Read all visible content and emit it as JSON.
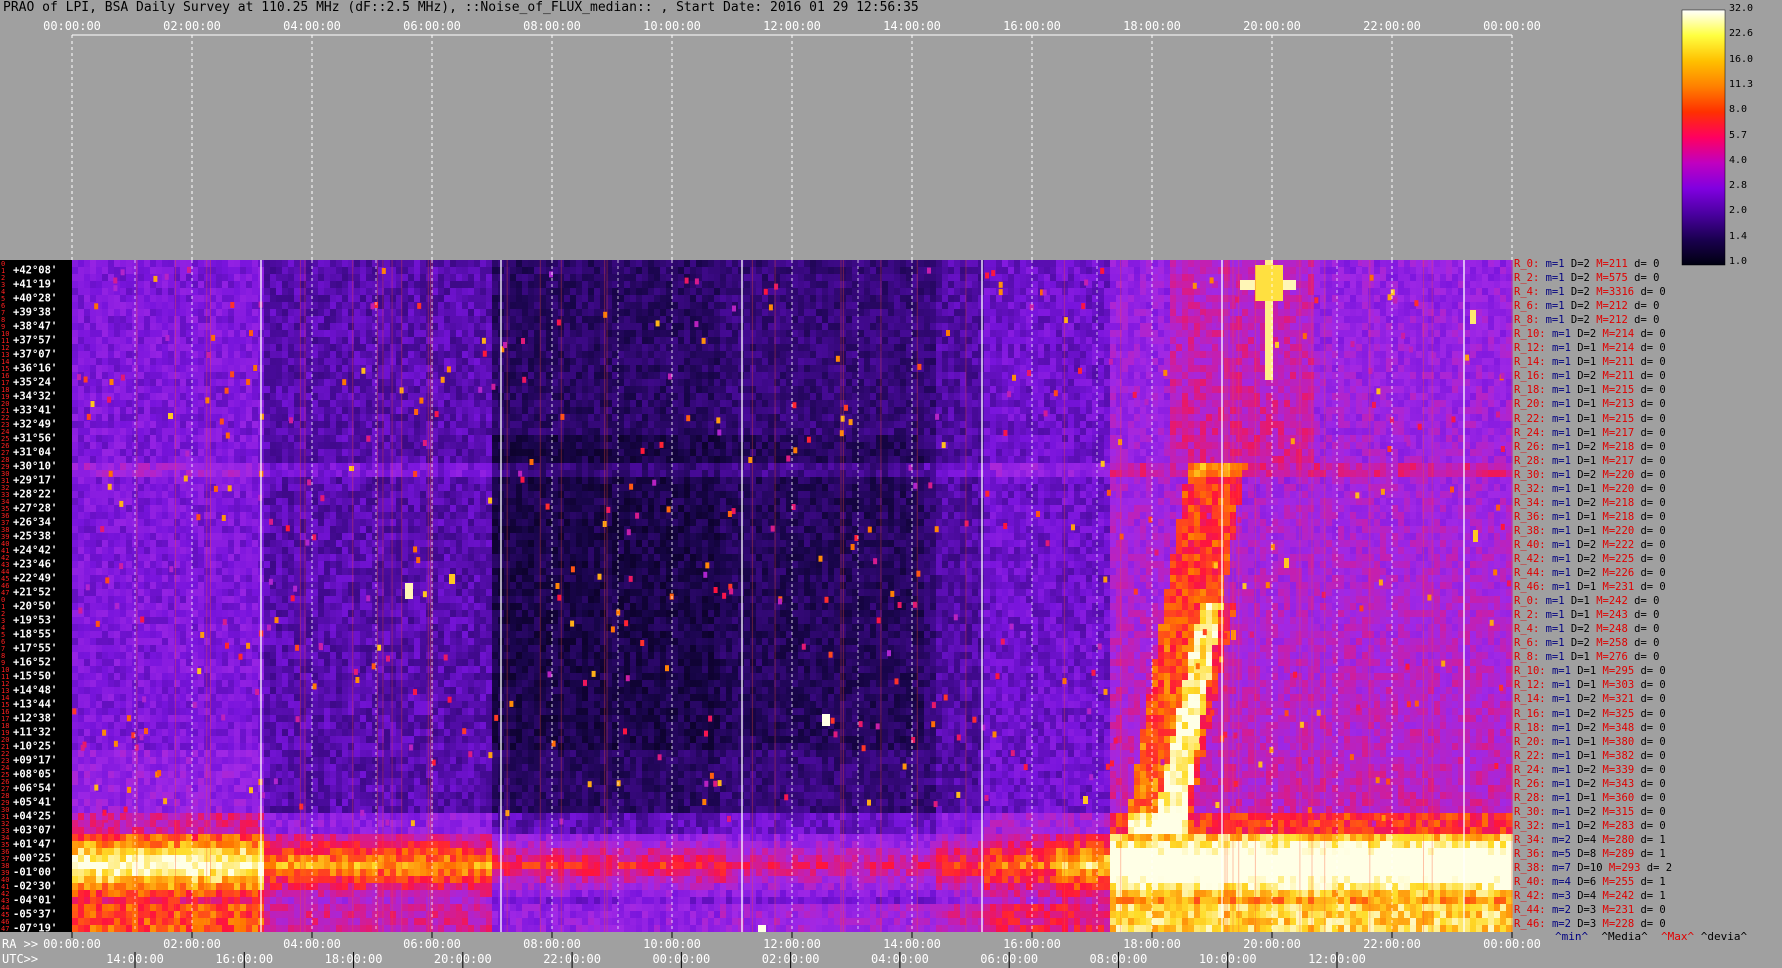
{
  "title": "PRAO of LPI, BSA Daily Survey at 110.25 MHz (dF::2.5 MHz), ::Noise_of_FLUX_median:: , Start Date: 2016 01 29 12:56:35",
  "chart_data": {
    "type": "heatmap",
    "title": "PRAO of LPI, BSA Daily Survey at 110.25 MHz (dF::2.5 MHz), ::Noise_of_FLUX_median:: , Start Date: 2016 01 29 12:56:35",
    "top_time_ticks": [
      "00:00:00",
      "02:00:00",
      "04:00:00",
      "06:00:00",
      "08:00:00",
      "10:00:00",
      "12:00:00",
      "14:00:00",
      "16:00:00",
      "18:00:00",
      "20:00:00",
      "22:00:00",
      "00:00:00"
    ],
    "ra_ticks": [
      "00:00:00",
      "02:00:00",
      "04:00:00",
      "06:00:00",
      "08:00:00",
      "10:00:00",
      "12:00:00",
      "14:00:00",
      "16:00:00",
      "18:00:00",
      "20:00:00",
      "22:00:00",
      "00:00:00"
    ],
    "utc_ticks": [
      "14:00:00",
      "16:00:00",
      "18:00:00",
      "20:00:00",
      "22:00:00",
      "00:00:00",
      "02:00:00",
      "04:00:00",
      "06:00:00",
      "08:00:00",
      "10:00:00",
      "12:00:00"
    ],
    "ra_label": "RA >>",
    "utc_label": "UTC>>",
    "colorbar_ticks": [
      "32.0",
      "22.6",
      "16.0",
      "11.3",
      "8.0",
      "5.7",
      "4.0",
      "2.8",
      "2.0",
      "1.4",
      "1.0"
    ],
    "colorbar_colors": [
      "#000010",
      "#1a0050",
      "#4a00a0",
      "#8000e0",
      "#c000c0",
      "#ff0060",
      "#ff3000",
      "#ff8000",
      "#ffc000",
      "#ffff40",
      "#ffffff"
    ],
    "row_numbers": [
      "0",
      "1",
      "2",
      "3",
      "4",
      "5",
      "6",
      "7",
      "8",
      "9",
      "10",
      "11",
      "12",
      "13",
      "14",
      "15",
      "16",
      "17",
      "18",
      "19",
      "20",
      "21",
      "22",
      "23",
      "24",
      "25",
      "26",
      "27",
      "28",
      "29",
      "30",
      "31",
      "32",
      "33",
      "34",
      "35",
      "36",
      "37",
      "38",
      "39",
      "40",
      "41",
      "42",
      "43",
      "44",
      "45",
      "46",
      "47",
      "0",
      "1",
      "2",
      "3",
      "4",
      "5",
      "6",
      "7",
      "8",
      "9",
      "10",
      "11",
      "12",
      "13",
      "14",
      "15",
      "16",
      "17",
      "18",
      "19",
      "20",
      "21",
      "22",
      "23",
      "24",
      "25",
      "26",
      "27",
      "28",
      "29",
      "30",
      "31",
      "32",
      "33",
      "34",
      "35",
      "36",
      "37",
      "38",
      "39",
      "40",
      "41",
      "42",
      "43",
      "44",
      "45",
      "46",
      "47"
    ],
    "declinations": [
      "+42°08'",
      "+41°19'",
      "+40°28'",
      "+39°38'",
      "+38°47'",
      "+37°57'",
      "+37°07'",
      "+36°16'",
      "+35°24'",
      "+34°32'",
      "+33°41'",
      "+32°49'",
      "+31°56'",
      "+31°04'",
      "+30°10'",
      "+29°17'",
      "+28°22'",
      "+27°28'",
      "+26°34'",
      "+25°38'",
      "+24°42'",
      "+23°46'",
      "+22°49'",
      "+21°52'",
      "+20°50'",
      "+19°53'",
      "+18°55'",
      "+17°55'",
      "+16°52'",
      "+15°50'",
      "+14°48'",
      "+13°44'",
      "+12°38'",
      "+11°32'",
      "+10°25'",
      "+09°17'",
      "+08°05'",
      "+06°54'",
      "+05°41'",
      "+04°25'",
      "+03°07'",
      "+01°47'",
      "+00°25'",
      "-01°00'",
      "-02°30'",
      "-04°01'",
      "-05°37'",
      "-07°19'"
    ],
    "stats": [
      {
        "r": "R_0:",
        "m": "m=1",
        "d": "D=2",
        "M": "M=211",
        "dv": "d= 0"
      },
      {
        "r": "R_2:",
        "m": "m=1",
        "d": "D=2",
        "M": "M=575",
        "dv": "d= 0"
      },
      {
        "r": "R_4:",
        "m": "m=1",
        "d": "D=2",
        "M": "M=3316",
        "dv": "d= 0"
      },
      {
        "r": "R_6:",
        "m": "m=1",
        "d": "D=2",
        "M": "M=212",
        "dv": "d= 0"
      },
      {
        "r": "R_8:",
        "m": "m=1",
        "d": "D=2",
        "M": "M=212",
        "dv": "d= 0"
      },
      {
        "r": "R_10:",
        "m": "m=1",
        "d": "D=2",
        "M": "M=214",
        "dv": "d= 0"
      },
      {
        "r": "R_12:",
        "m": "m=1",
        "d": "D=1",
        "M": "M=214",
        "dv": "d= 0"
      },
      {
        "r": "R_14:",
        "m": "m=1",
        "d": "D=1",
        "M": "M=211",
        "dv": "d= 0"
      },
      {
        "r": "R_16:",
        "m": "m=1",
        "d": "D=2",
        "M": "M=211",
        "dv": "d= 0"
      },
      {
        "r": "R_18:",
        "m": "m=1",
        "d": "D=1",
        "M": "M=215",
        "dv": "d= 0"
      },
      {
        "r": "R_20:",
        "m": "m=1",
        "d": "D=1",
        "M": "M=213",
        "dv": "d= 0"
      },
      {
        "r": "R_22:",
        "m": "m=1",
        "d": "D=1",
        "M": "M=215",
        "dv": "d= 0"
      },
      {
        "r": "R_24:",
        "m": "m=1",
        "d": "D=1",
        "M": "M=217",
        "dv": "d= 0"
      },
      {
        "r": "R_26:",
        "m": "m=1",
        "d": "D=2",
        "M": "M=218",
        "dv": "d= 0"
      },
      {
        "r": "R_28:",
        "m": "m=1",
        "d": "D=1",
        "M": "M=217",
        "dv": "d= 0"
      },
      {
        "r": "R_30:",
        "m": "m=1",
        "d": "D=2",
        "M": "M=220",
        "dv": "d= 0"
      },
      {
        "r": "R_32:",
        "m": "m=1",
        "d": "D=1",
        "M": "M=220",
        "dv": "d= 0"
      },
      {
        "r": "R_34:",
        "m": "m=1",
        "d": "D=2",
        "M": "M=218",
        "dv": "d= 0"
      },
      {
        "r": "R_36:",
        "m": "m=1",
        "d": "D=1",
        "M": "M=218",
        "dv": "d= 0"
      },
      {
        "r": "R_38:",
        "m": "m=1",
        "d": "D=1",
        "M": "M=220",
        "dv": "d= 0"
      },
      {
        "r": "R_40:",
        "m": "m=1",
        "d": "D=2",
        "M": "M=222",
        "dv": "d= 0"
      },
      {
        "r": "R_42:",
        "m": "m=1",
        "d": "D=2",
        "M": "M=225",
        "dv": "d= 0"
      },
      {
        "r": "R_44:",
        "m": "m=1",
        "d": "D=2",
        "M": "M=226",
        "dv": "d= 0"
      },
      {
        "r": "R_46:",
        "m": "m=1",
        "d": "D=1",
        "M": "M=231",
        "dv": "d= 0"
      },
      {
        "r": "R_0:",
        "m": "m=1",
        "d": "D=1",
        "M": "M=242",
        "dv": "d= 0"
      },
      {
        "r": "R_2:",
        "m": "m=1",
        "d": "D=1",
        "M": "M=243",
        "dv": "d= 0"
      },
      {
        "r": "R_4:",
        "m": "m=1",
        "d": "D=2",
        "M": "M=248",
        "dv": "d= 0"
      },
      {
        "r": "R_6:",
        "m": "m=1",
        "d": "D=2",
        "M": "M=258",
        "dv": "d= 0"
      },
      {
        "r": "R_8:",
        "m": "m=1",
        "d": "D=1",
        "M": "M=276",
        "dv": "d= 0"
      },
      {
        "r": "R_10:",
        "m": "m=1",
        "d": "D=1",
        "M": "M=295",
        "dv": "d= 0"
      },
      {
        "r": "R_12:",
        "m": "m=1",
        "d": "D=1",
        "M": "M=303",
        "dv": "d= 0"
      },
      {
        "r": "R_14:",
        "m": "m=1",
        "d": "D=2",
        "M": "M=321",
        "dv": "d= 0"
      },
      {
        "r": "R_16:",
        "m": "m=1",
        "d": "D=2",
        "M": "M=325",
        "dv": "d= 0"
      },
      {
        "r": "R_18:",
        "m": "m=1",
        "d": "D=2",
        "M": "M=348",
        "dv": "d= 0"
      },
      {
        "r": "R_20:",
        "m": "m=1",
        "d": "D=1",
        "M": "M=380",
        "dv": "d= 0"
      },
      {
        "r": "R_22:",
        "m": "m=1",
        "d": "D=1",
        "M": "M=382",
        "dv": "d= 0"
      },
      {
        "r": "R_24:",
        "m": "m=1",
        "d": "D=2",
        "M": "M=339",
        "dv": "d= 0"
      },
      {
        "r": "R_26:",
        "m": "m=1",
        "d": "D=2",
        "M": "M=343",
        "dv": "d= 0"
      },
      {
        "r": "R_28:",
        "m": "m=1",
        "d": "D=1",
        "M": "M=360",
        "dv": "d= 0"
      },
      {
        "r": "R_30:",
        "m": "m=1",
        "d": "D=2",
        "M": "M=315",
        "dv": "d= 0"
      },
      {
        "r": "R_32:",
        "m": "m=1",
        "d": "D=2",
        "M": "M=283",
        "dv": "d= 0"
      },
      {
        "r": "R_34:",
        "m": "m=2",
        "d": "D=4",
        "M": "M=280",
        "dv": "d= 1"
      },
      {
        "r": "R_36:",
        "m": "m=5",
        "d": "D=8",
        "M": "M=289",
        "dv": "d= 1"
      },
      {
        "r": "R_38:",
        "m": "m=7",
        "d": "D=10",
        "M": "M=293",
        "dv": "d= 2"
      },
      {
        "r": "R_40:",
        "m": "m=4",
        "d": "D=6",
        "M": "M=255",
        "dv": "d= 1"
      },
      {
        "r": "R_42:",
        "m": "m=3",
        "d": "D=4",
        "M": "M=242",
        "dv": "d= 1"
      },
      {
        "r": "R_44:",
        "m": "m=2",
        "d": "D=3",
        "M": "M=231",
        "dv": "d= 0"
      },
      {
        "r": "R_46:",
        "m": "m=2",
        "d": "D=3",
        "M": "M=228",
        "dv": "d= 0"
      }
    ],
    "legend": {
      "min": "^min^",
      "median": "^Media^",
      "max": "^Max^",
      "dev": "^devia^"
    }
  }
}
